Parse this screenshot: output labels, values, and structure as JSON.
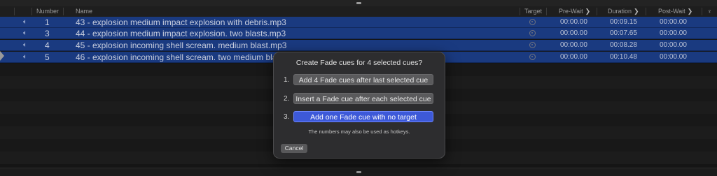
{
  "columns": {
    "number": "Number",
    "name": "Name",
    "target": "Target",
    "pre_wait": "Pre-Wait",
    "duration": "Duration",
    "post_wait": "Post-Wait",
    "chevron": "❯"
  },
  "cues": [
    {
      "number": "1",
      "name": "43 - explosion medium impact explosion with debris.mp3",
      "pre_wait": "00:00.00",
      "duration": "00:09.15",
      "post_wait": "00:00.00"
    },
    {
      "number": "3",
      "name": "44 - explosion medium impact explosion. two blasts.mp3",
      "pre_wait": "00:00.00",
      "duration": "00:07.65",
      "post_wait": "00:00.00"
    },
    {
      "number": "4",
      "name": "45 - explosion incoming shell scream. medium blast.mp3",
      "pre_wait": "00:00.00",
      "duration": "00:08.28",
      "post_wait": "00:00.00"
    },
    {
      "number": "5",
      "name": "46 - explosion incoming shell scream. two medium bla",
      "pre_wait": "00:00.00",
      "duration": "00:10.48",
      "post_wait": "00:00.00"
    }
  ],
  "dialog": {
    "title": "Create Fade cues for 4 selected cues?",
    "options": [
      {
        "num": "1.",
        "label": "Add 4 Fade cues after last selected cue"
      },
      {
        "num": "2.",
        "label": "Insert a Fade cue after each selected cue"
      },
      {
        "num": "3.",
        "label": "Add one Fade cue with no target"
      }
    ],
    "hint": "The numbers may also be used as hotkeys.",
    "cancel": "Cancel"
  },
  "icons": {
    "speaker": "speaker-icon",
    "target": "target-icon",
    "chevron": "chevron-right-icon"
  },
  "colors": {
    "selection": "#1a3a80",
    "primary_button": "#3d59d8",
    "background": "#151515"
  }
}
